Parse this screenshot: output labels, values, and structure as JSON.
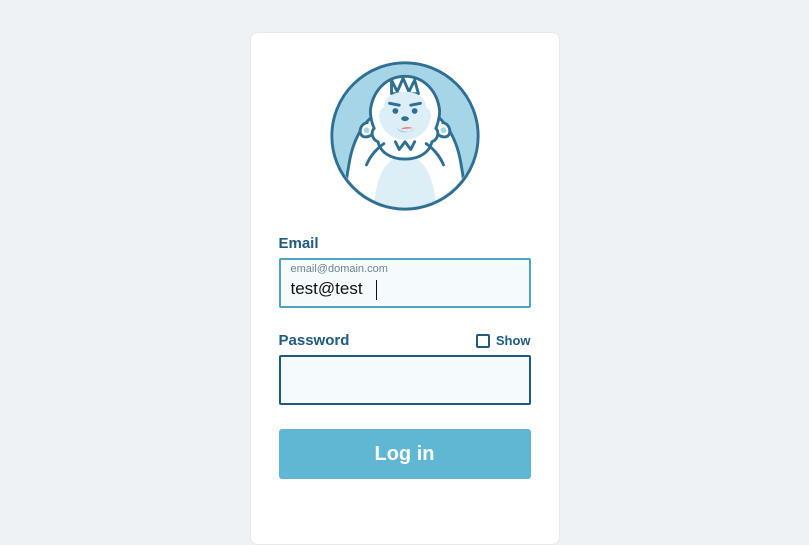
{
  "form": {
    "email_label": "Email",
    "email_hint": "email@domain.com",
    "email_value": "test@test",
    "password_label": "Password",
    "password_value": "",
    "show_label": "Show",
    "submit_label": "Log in"
  },
  "colors": {
    "accent": "#5fb7d4",
    "label": "#1f5a80",
    "input_border_focus": "#4ca3c4",
    "input_bg": "#f5fafc",
    "page_bg": "#eef2f4"
  }
}
